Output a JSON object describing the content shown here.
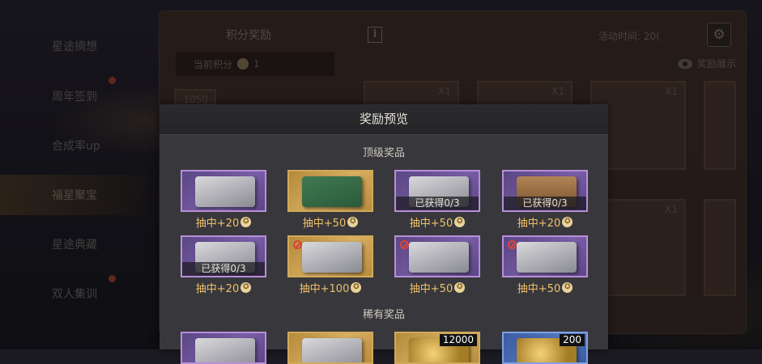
{
  "sidebar": {
    "items": [
      {
        "label": "星途摘想"
      },
      {
        "label": "周年签到"
      },
      {
        "label": "合成率up"
      },
      {
        "label": "福星聚宝"
      },
      {
        "label": "星途典藏"
      },
      {
        "label": "双人集训"
      }
    ]
  },
  "event_panel": {
    "title": "积分奖励",
    "info_icon": "i",
    "time_label": "活动时间: 20(",
    "points_label": "当前积分",
    "points_value": "1",
    "reward_display_label": "奖励展示",
    "card_qty": "X1",
    "badge": "1050"
  },
  "modal": {
    "title": "奖励预览",
    "top_section": "顶级奖品",
    "rare_section": "稀有奖品",
    "obtained_text": "已获得0/3",
    "star_symbol": "✪",
    "top_rewards": [
      {
        "caption": "抽中+20",
        "kind": "purple",
        "art": "gun",
        "obtained": false,
        "locked": false
      },
      {
        "caption": "抽中+50",
        "kind": "gold",
        "art": "box",
        "obtained": false,
        "locked": false
      },
      {
        "caption": "抽中+50",
        "kind": "purple",
        "art": "gun",
        "obtained": true,
        "locked": false
      },
      {
        "caption": "抽中+20",
        "kind": "purple",
        "art": "crate",
        "obtained": true,
        "locked": false
      },
      {
        "caption": "抽中+20",
        "kind": "purple",
        "art": "gun",
        "obtained": true,
        "locked": false
      },
      {
        "caption": "抽中+100",
        "kind": "gold",
        "art": "gun",
        "obtained": false,
        "locked": true
      },
      {
        "caption": "抽中+50",
        "kind": "purple",
        "art": "gun",
        "obtained": false,
        "locked": true
      },
      {
        "caption": "抽中+50",
        "kind": "purple",
        "art": "gun",
        "obtained": false,
        "locked": true
      }
    ],
    "rare_rewards": [
      {
        "qty": "",
        "kind": "purple"
      },
      {
        "qty": "",
        "kind": "gold"
      },
      {
        "qty": "12000",
        "kind": "gold"
      },
      {
        "qty": "200",
        "kind": "blue"
      }
    ]
  }
}
